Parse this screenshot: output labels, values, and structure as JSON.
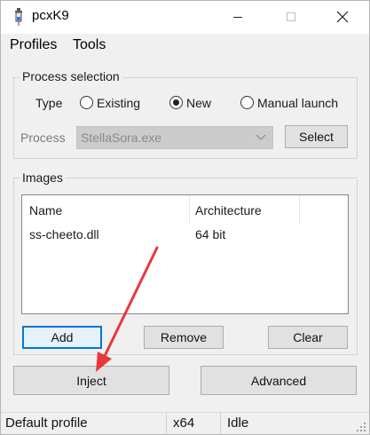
{
  "window": {
    "title": "pcxK9"
  },
  "menu": {
    "items": [
      "Profiles",
      "Tools"
    ]
  },
  "process_selection": {
    "title": "Process selection",
    "type_label": "Type",
    "options": [
      {
        "label": "Existing",
        "selected": false
      },
      {
        "label": "New",
        "selected": true
      },
      {
        "label": "Manual launch",
        "selected": false
      }
    ],
    "process_label": "Process",
    "process_value": "StellaSora.exe",
    "select_button": "Select"
  },
  "images": {
    "title": "Images",
    "columns": [
      "Name",
      "Architecture"
    ],
    "rows": [
      {
        "name": "ss-cheeto.dll",
        "arch": "64 bit"
      }
    ],
    "add_button": "Add",
    "remove_button": "Remove",
    "clear_button": "Clear"
  },
  "actions": {
    "inject_button": "Inject",
    "advanced_button": "Advanced"
  },
  "status": {
    "profile": "Default profile",
    "arch": "x64",
    "state": "Idle"
  },
  "colors": {
    "accent": "#0078d7",
    "annotation_arrow": "#e8383d"
  }
}
